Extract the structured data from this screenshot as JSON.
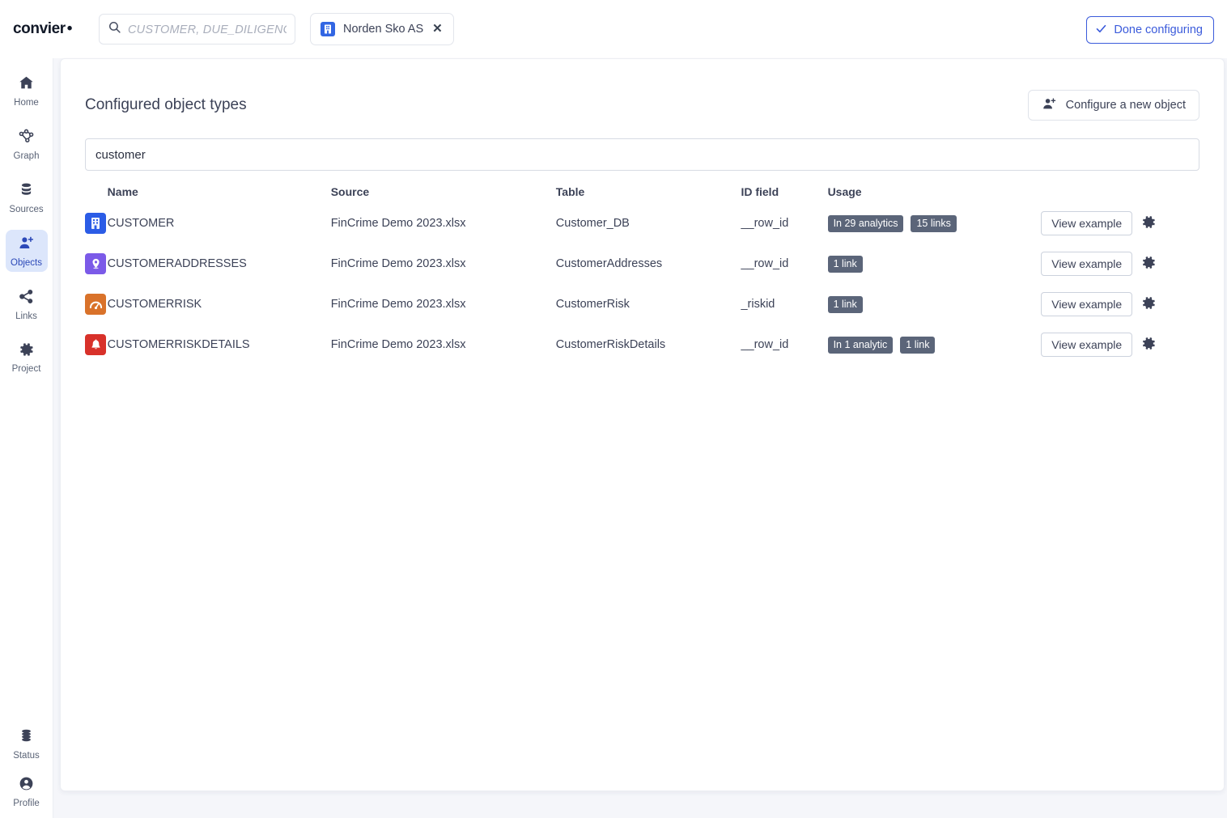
{
  "brand": {
    "name": "convier",
    "mark": "•"
  },
  "search": {
    "placeholder": "CUSTOMER, DUE_DILIGENCE.",
    "value": "",
    "icon": "search-icon"
  },
  "tab_chip": {
    "label": "Norden Sko AS",
    "icon": "building-icon",
    "close": "✕",
    "accent": "#3266e3"
  },
  "done_button": {
    "label": "Done configuring",
    "icon": "check-icon",
    "accent": "#3b5bdb"
  },
  "sidebar": {
    "items": [
      {
        "label": "Home",
        "icon": "home-icon",
        "active": false
      },
      {
        "label": "Graph",
        "icon": "graph-icon",
        "active": false
      },
      {
        "label": "Sources",
        "icon": "database-icon",
        "active": false
      },
      {
        "label": "Objects",
        "icon": "add-user-icon",
        "active": true
      },
      {
        "label": "Links",
        "icon": "share-icon",
        "active": false
      },
      {
        "label": "Project",
        "icon": "gear-icon",
        "active": false
      }
    ],
    "bottom_items": [
      {
        "label": "Status",
        "icon": "stack-icon",
        "active": false
      },
      {
        "label": "Profile",
        "icon": "person-icon",
        "active": false
      }
    ],
    "active_bg": "#dce6fb"
  },
  "main": {
    "title": "Configured object types",
    "new_object_button": {
      "label": "Configure a new object",
      "icon": "add-user-icon"
    },
    "filter": {
      "value": "customer",
      "placeholder": ""
    },
    "columns": {
      "icon": "",
      "name": "Name",
      "source": "Source",
      "table": "Table",
      "id_field": "ID field",
      "usage": "Usage",
      "example": "",
      "settings": ""
    },
    "row_action_label": "View example",
    "row_settings_icon": "gear-icon",
    "rows": [
      {
        "icon": "building-icon",
        "icon_bg": "#2b5ce6",
        "name": "CUSTOMER",
        "source": "FinCrime Demo 2023.xlsx",
        "table": "Customer_DB",
        "id_field": "__row_id",
        "usage": [
          "In 29 analytics",
          "15 links"
        ]
      },
      {
        "icon": "location-pin-icon",
        "icon_bg": "#7b5ae8",
        "name": "CUSTOMERADDRESSES",
        "source": "FinCrime Demo 2023.xlsx",
        "table": "CustomerAddresses",
        "id_field": "__row_id",
        "usage": [
          "1 link"
        ]
      },
      {
        "icon": "gauge-icon",
        "icon_bg": "#d9722a",
        "name": "CUSTOMERRISK",
        "source": "FinCrime Demo 2023.xlsx",
        "table": "CustomerRisk",
        "id_field": "_riskid",
        "usage": [
          "1 link"
        ]
      },
      {
        "icon": "bell-icon",
        "icon_bg": "#d8312a",
        "name": "CUSTOMERRISKDETAILS",
        "source": "FinCrime Demo 2023.xlsx",
        "table": "CustomerRiskDetails",
        "id_field": "__row_id",
        "usage": [
          "In 1 analytic",
          "1 link"
        ]
      }
    ]
  },
  "colors": {
    "page_bg": "#f5f6fa",
    "badge_bg": "#5b6579",
    "text": "#3c4257",
    "accent": "#3b5bdb"
  }
}
